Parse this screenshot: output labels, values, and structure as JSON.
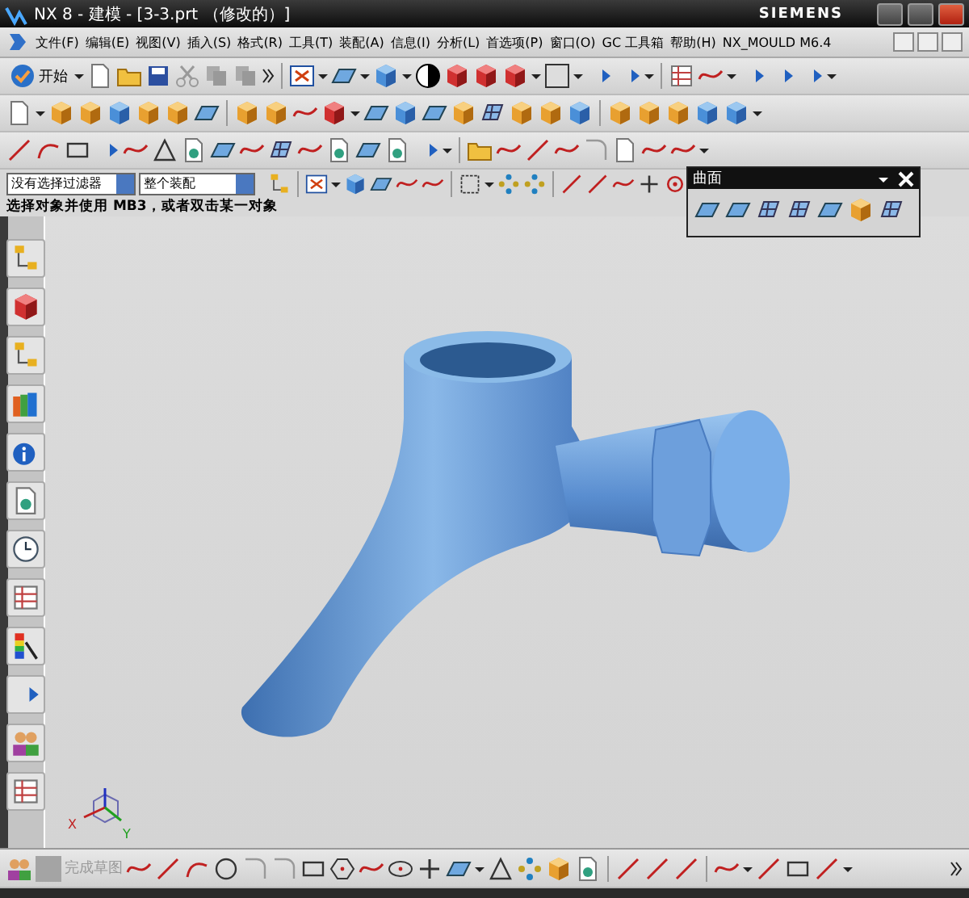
{
  "window": {
    "title": "NX 8 - 建模 - [3-3.prt （修改的）]",
    "brand": "SIEMENS"
  },
  "menu_bar": {
    "items": [
      "文件(F)",
      "编辑(E)",
      "视图(V)",
      "插入(S)",
      "格式(R)",
      "工具(T)",
      "装配(A)",
      "信息(I)",
      "分析(L)",
      "首选项(P)",
      "窗口(O)",
      "GC 工具箱",
      "帮助(H)",
      "NX_MOULD M6.4"
    ]
  },
  "standard_toolbar": {
    "start_button": "开始"
  },
  "selection_bar": {
    "filter": "没有选择过滤器",
    "scope": "整个装配"
  },
  "cue_line": "选择对象并使用 MB3，或者双击某一对象",
  "surface_palette": {
    "title": "曲面"
  },
  "sketch_toolbar": {
    "finish_button": {
      "label": "完成草图",
      "disabled": true
    }
  },
  "triad": {
    "x_label": "X",
    "y_label": "Y"
  }
}
